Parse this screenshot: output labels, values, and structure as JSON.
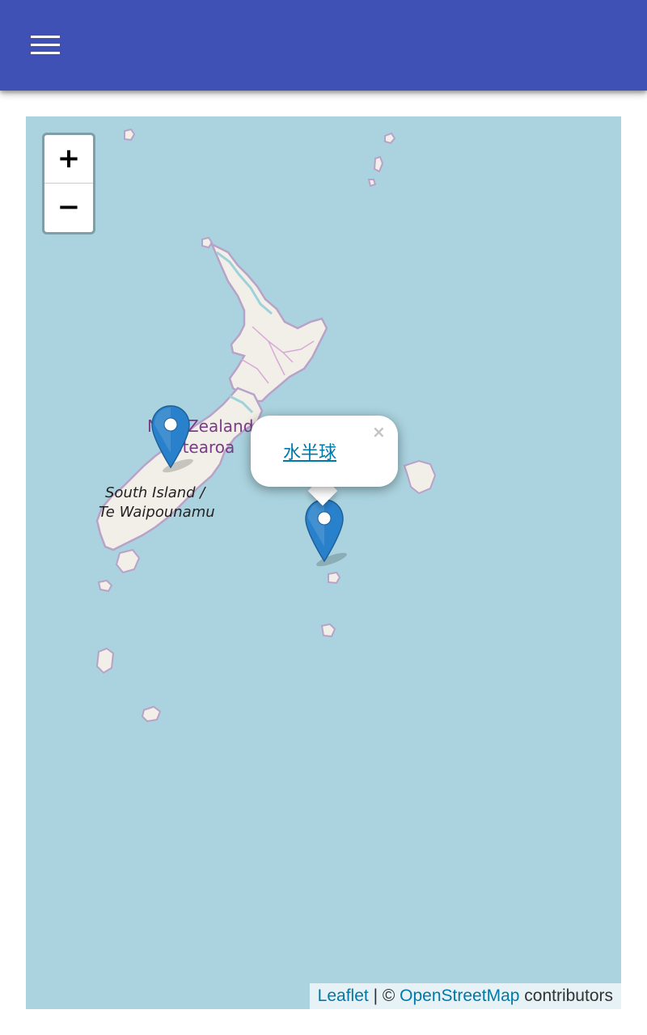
{
  "app_bar": {
    "background_color": "#3f51b5",
    "menu_icon": "hamburger-menu-icon"
  },
  "map": {
    "water_color": "#aad3df",
    "land_color": "#f2efe9",
    "labels": {
      "country_line1": "New Zealand /",
      "country_line2": "Aotearoa",
      "island_line1": "South Island /",
      "island_line2": "Te Waipounamu"
    },
    "zoom": {
      "in_label": "+",
      "out_label": "−"
    },
    "markers": [
      {
        "name": "marker-1",
        "icon": "map-pin-icon"
      },
      {
        "name": "marker-2",
        "icon": "map-pin-icon"
      }
    ],
    "popup": {
      "link_text": "水半球",
      "close_label": "×"
    },
    "attribution": {
      "leaflet": "Leaflet",
      "separator": " | © ",
      "osm": "OpenStreetMap",
      "suffix": " contributors"
    }
  }
}
